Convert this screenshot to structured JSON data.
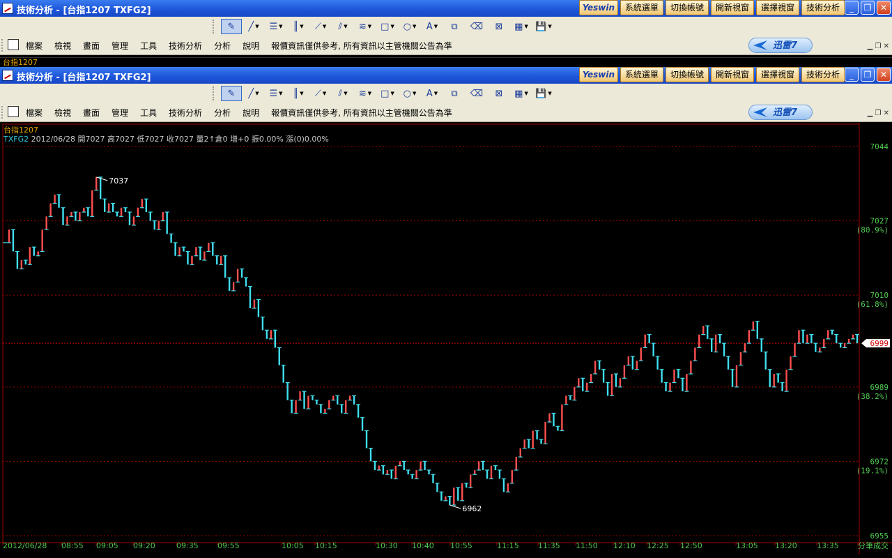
{
  "window": {
    "title": "技術分析 - [台指1207 TXFG2]",
    "top_buttons": [
      "Yeswin",
      "系統選單",
      "切換帳號",
      "開新視窗",
      "選擇視窗",
      "技術分析"
    ]
  },
  "menu": {
    "items": [
      "檔案",
      "檢視",
      "畫面",
      "管理",
      "工具",
      "技術分析",
      "分析",
      "說明"
    ],
    "marquee": "報價資訊僅供參考, 所有資訊以主管機關公告為準",
    "xunlei_label": "迅雷7"
  },
  "toolbar": {
    "icons": [
      "select-draw-icon",
      "line-tool-icon",
      "text-line-icon",
      "vertical-lines-icon",
      "fan-icon",
      "channel-icon",
      "parallel-icon",
      "rectangle-icon",
      "ellipse-icon",
      "text-tool-icon",
      "copy-icon",
      "eraser-icon",
      "clear-icon",
      "color-grid-icon",
      "save-icon"
    ]
  },
  "sub_label": "台指1207",
  "chart_info": {
    "symbol_label": "台指1207",
    "symbol": "TXFG2",
    "text": "2012/06/28 開7027 高7027 低7027 收7027 量2↑倉0 增+0 振0.00% 漲(0)0.00%"
  },
  "colors": {
    "up": "#ff5050",
    "down": "#40e0f0",
    "grid": "#a00000",
    "axis_text": "#50c850",
    "last_price_bg": "#ffffff",
    "last_price_text": "#d00000"
  },
  "chart_data": {
    "type": "line",
    "x_label_ticks": [
      "2012/06/28",
      "08:55",
      "09:05",
      "09:20",
      "09:35",
      "09:55",
      "10:05",
      "10:15",
      "10:30",
      "10:40",
      "10:55",
      "11:15",
      "11:35",
      "11:50",
      "12:10",
      "12:25",
      "12:50",
      "13:05",
      "13:20",
      "13:35",
      "分筆成交"
    ],
    "y_ticks": [
      {
        "value": 7044,
        "pct": ""
      },
      {
        "value": 7027,
        "pct": "(80.9%)"
      },
      {
        "value": 7010,
        "pct": "(61.8%)"
      },
      {
        "value": 6989,
        "pct": "(38.2%)"
      },
      {
        "value": 6972,
        "pct": "(19.1%)"
      },
      {
        "value": 6955,
        "pct": ""
      }
    ],
    "ylim": [
      6955,
      7044
    ],
    "last_price": 6999,
    "high_annotation": {
      "value": 7037,
      "label": "7037"
    },
    "low_annotation": {
      "value": 6962,
      "label": "6962"
    },
    "series": [
      {
        "values": [
          7022,
          7025,
          7020,
          7016,
          7018,
          7017,
          7021,
          7019,
          7020,
          7025,
          7028,
          7031,
          7033,
          7030,
          7026,
          7028,
          7029,
          7027,
          7029,
          7030,
          7028,
          7034,
          7037,
          7032,
          7029,
          7031,
          7029,
          7028,
          7030,
          7029,
          7026,
          7028,
          7030,
          7032,
          7029,
          7027,
          7025,
          7027,
          7029,
          7024,
          7022,
          7019,
          7021,
          7020,
          7017,
          7019,
          7021,
          7018,
          7020,
          7022,
          7019,
          7017,
          7019,
          7014,
          7011,
          7013,
          7016,
          7014,
          7012,
          7007,
          7009,
          7005,
          7002,
          7000,
          7002,
          6998,
          6994,
          6990,
          6986,
          6983,
          6986,
          6988,
          6984,
          6987,
          6986,
          6985,
          6983,
          6984,
          6986,
          6987,
          6985,
          6983,
          6986,
          6987,
          6985,
          6982,
          6979,
          6975,
          6972,
          6970,
          6971,
          6969,
          6970,
          6968,
          6971,
          6972,
          6970,
          6969,
          6968,
          6970,
          6972,
          6970,
          6969,
          6967,
          6965,
          6963,
          6964,
          6962,
          6966,
          6963,
          6967,
          6966,
          6969,
          6970,
          6972,
          6970,
          6968,
          6971,
          6970,
          6968,
          6965,
          6967,
          6970,
          6973,
          6975,
          6977,
          6975,
          6979,
          6977,
          6976,
          6981,
          6983,
          6980,
          6979,
          6985,
          6987,
          6986,
          6989,
          6991,
          6988,
          6990,
          6992,
          6995,
          6993,
          6990,
          6987,
          6992,
          6989,
          6991,
          6994,
          6996,
          6993,
          6995,
          6998,
          7001,
          6999,
          6996,
          6993,
          6990,
          6988,
          6990,
          6993,
          6991,
          6988,
          6992,
          6995,
          6998,
          7001,
          7003,
          7000,
          6997,
          7001,
          6999,
          6996,
          6993,
          6989,
          6994,
          6997,
          6999,
          7002,
          7004,
          7000,
          6997,
          6993,
          6989,
          6992,
          6990,
          6988,
          6993,
          6996,
          6999,
          7002,
          6999,
          7001,
          6999,
          6997,
          6998,
          7000,
          7002,
          7001,
          6999,
          6998,
          6999,
          7000,
          7001,
          6999
        ]
      }
    ]
  }
}
